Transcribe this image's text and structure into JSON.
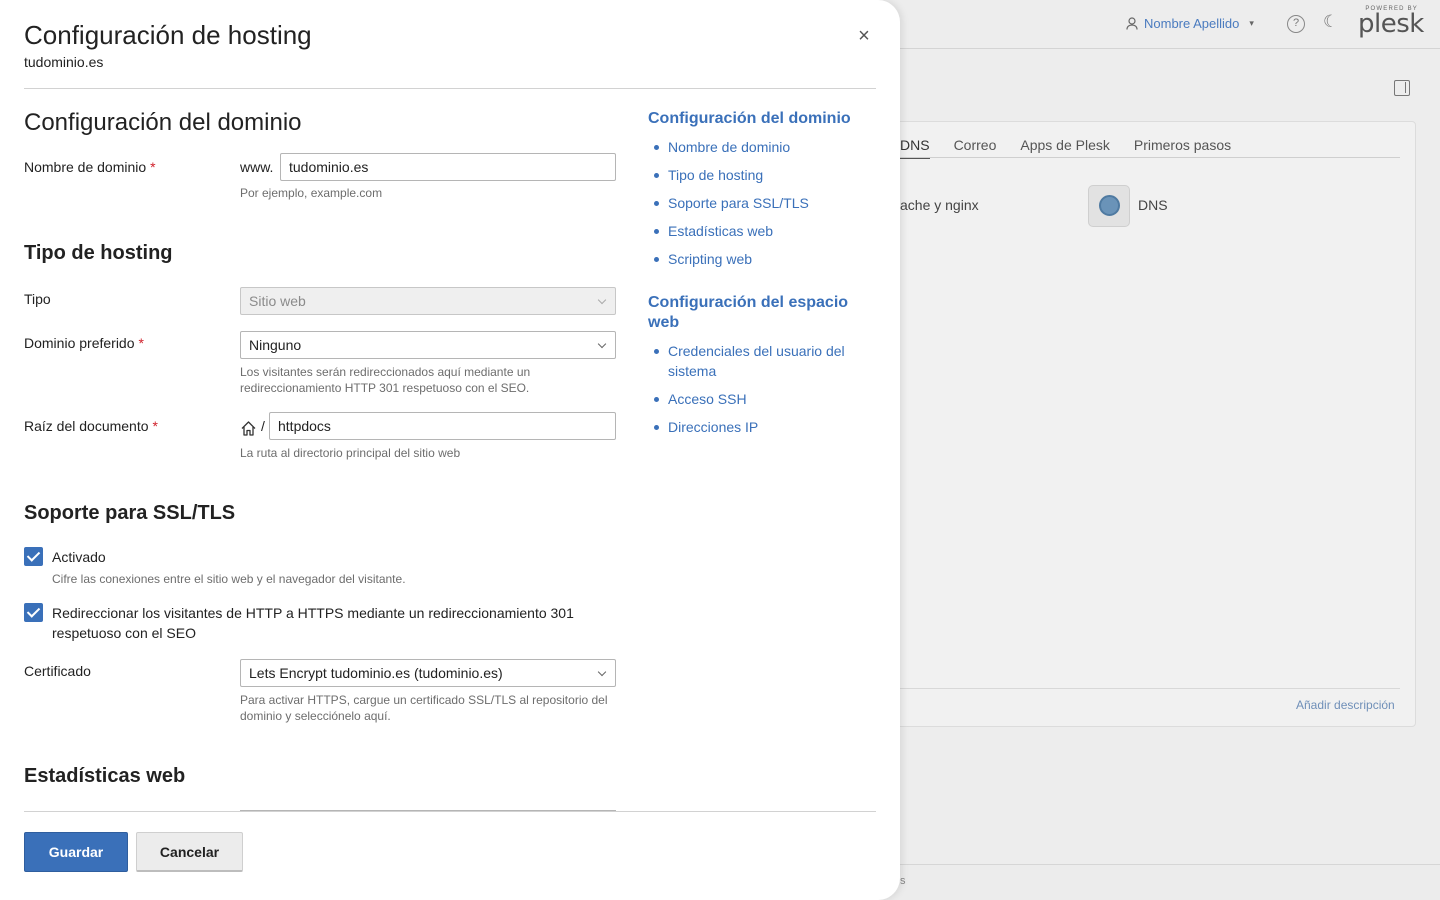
{
  "background": {
    "user_name": "Nombre Apellido",
    "help_symbol": "?",
    "brand_powered": "POWERED BY",
    "brand_name": "plesk",
    "tabs": [
      "DNS",
      "Correo",
      "Apps de Plesk",
      "Primeros pasos"
    ],
    "apache_text": "ache y nginx",
    "dns_label": "DNS",
    "add_description": "Añadir descripción",
    "footer_text": "s"
  },
  "drawer": {
    "title": "Configuración de hosting",
    "subtitle": "tudominio.es",
    "close_label": "×"
  },
  "form": {
    "domain_section_title": "Configuración del dominio",
    "domain_name_label": "Nombre de dominio",
    "required_mark": "*",
    "www_prefix": "www.",
    "domain_value": "tudominio.es",
    "domain_hint": "Por ejemplo, example.com",
    "hosting_section_title": "Tipo de hosting",
    "type_label": "Tipo",
    "type_value": "Sitio web",
    "preferred_label": "Dominio preferido",
    "preferred_value": "Ninguno",
    "preferred_hint": "Los visitantes serán redireccionados aquí mediante un redireccionamiento HTTP 301 respetuoso con el SEO.",
    "docroot_label": "Raíz del documento",
    "docroot_slash": "/",
    "docroot_value": "httpdocs",
    "docroot_hint": "La ruta al directorio principal del sitio web",
    "ssl_section_title": "Soporte para SSL/TLS",
    "ssl_enabled_label": "Activado",
    "ssl_enabled_checked": true,
    "ssl_enabled_hint": "Cifre las conexiones entre el sitio web y el navegador del visitante.",
    "redirect_label": "Redireccionar los visitantes de HTTP a HTTPS mediante un redireccionamiento 301 respetuoso con el SEO",
    "redirect_checked": true,
    "certificate_label": "Certificado",
    "certificate_value": "Lets Encrypt tudominio.es (tudominio.es)",
    "certificate_hint": "Para activar HTTPS, cargue un certificado SSL/TLS al repositorio del dominio y selecciónelo aquí.",
    "stats_section_title": "Estadísticas web"
  },
  "toc": {
    "group1_title": "Configuración del dominio",
    "group1_items": [
      "Nombre de dominio",
      "Tipo de hosting",
      "Soporte para SSL/TLS",
      "Estadísticas web",
      "Scripting web"
    ],
    "group2_title": "Configuración del espacio web",
    "group2_items": [
      "Credenciales del usuario del sistema",
      "Acceso SSH",
      "Direcciones IP"
    ]
  },
  "actions": {
    "save_label": "Guardar",
    "cancel_label": "Cancelar"
  },
  "colors": {
    "accent": "#3a70b9",
    "required": "#d0202a"
  }
}
